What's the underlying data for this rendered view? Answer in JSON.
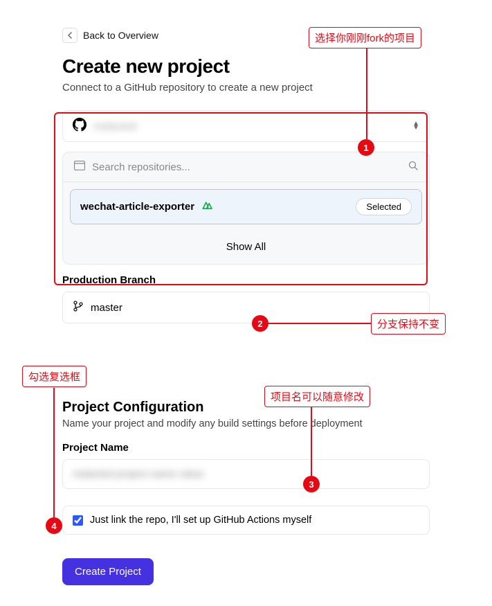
{
  "back": {
    "label": "Back to Overview"
  },
  "header": {
    "title": "Create new project",
    "subtitle": "Connect to a GitHub repository to create a new project"
  },
  "owner": {
    "name_redacted": "redacted"
  },
  "repo_search": {
    "placeholder": "Search repositories..."
  },
  "repo": {
    "name": "wechat-article-exporter",
    "selected_label": "Selected"
  },
  "show_all": "Show All",
  "branch": {
    "label": "Production Branch",
    "value": "master"
  },
  "config": {
    "title": "Project Configuration",
    "subtitle": "Name your project and modify any build settings before deployment",
    "project_name_label": "Project Name",
    "project_name_value_redacted": "redacted project name value"
  },
  "checkbox": {
    "label": "Just link the repo, I'll set up GitHub Actions myself",
    "checked": true
  },
  "create_button": "Create Project",
  "annotations": {
    "a1": "选择你刚刚fork的项目",
    "a2": "分支保持不变",
    "a3": "项目名可以随意修改",
    "a4": "勾选复选框",
    "n1": "1",
    "n2": "2",
    "n3": "3",
    "n4": "4"
  }
}
